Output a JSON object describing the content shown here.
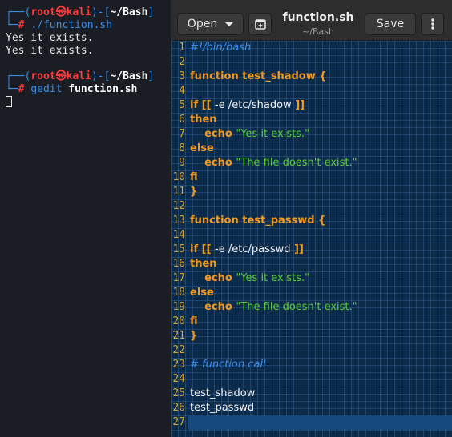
{
  "terminal": {
    "prompt1": {
      "user": "root",
      "at": "㉿",
      "host": "kali",
      "dir": "~/Bash",
      "command": "./function.sh"
    },
    "output": [
      "Yes it exists.",
      "Yes it exists."
    ],
    "prompt2": {
      "user": "root",
      "at": "㉿",
      "host": "kali",
      "dir": "~/Bash",
      "command_cmd": "gedit",
      "command_arg": "function.sh"
    }
  },
  "gedit": {
    "open_label": "Open",
    "save_label": "Save",
    "title": "function.sh",
    "subtitle": "~/Bash",
    "icons": {
      "open_dropdown": "chevron-down-icon",
      "new_tab": "new-tab-icon",
      "menu": "vertical-ellipsis-icon"
    },
    "current_line": 27,
    "lines": [
      {
        "n": "1",
        "parts": [
          {
            "t": "#!/bin/bash",
            "c": "shebang"
          }
        ]
      },
      {
        "n": "2",
        "parts": []
      },
      {
        "n": "3",
        "parts": [
          {
            "t": "function test_shadow {",
            "c": "kw"
          }
        ]
      },
      {
        "n": "4",
        "parts": []
      },
      {
        "n": "5",
        "parts": [
          {
            "t": "if [[ ",
            "c": "kw"
          },
          {
            "t": "-e /etc/shadow",
            "c": "plain"
          },
          {
            "t": " ]]",
            "c": "kw"
          }
        ]
      },
      {
        "n": "6",
        "parts": [
          {
            "t": "then",
            "c": "kw"
          }
        ]
      },
      {
        "n": "7",
        "parts": [
          {
            "t": "    echo ",
            "c": "kw"
          },
          {
            "t": "\"Yes it exists.\"",
            "c": "str"
          }
        ]
      },
      {
        "n": "8",
        "parts": [
          {
            "t": "else",
            "c": "kw"
          }
        ]
      },
      {
        "n": "9",
        "parts": [
          {
            "t": "    echo ",
            "c": "kw"
          },
          {
            "t": "\"The file doesn't exist.\"",
            "c": "str"
          }
        ]
      },
      {
        "n": "10",
        "parts": [
          {
            "t": "fi",
            "c": "kw"
          }
        ]
      },
      {
        "n": "11",
        "parts": [
          {
            "t": "}",
            "c": "kw"
          }
        ]
      },
      {
        "n": "12",
        "parts": []
      },
      {
        "n": "13",
        "parts": [
          {
            "t": "function test_passwd {",
            "c": "kw"
          }
        ]
      },
      {
        "n": "14",
        "parts": []
      },
      {
        "n": "15",
        "parts": [
          {
            "t": "if [[ ",
            "c": "kw"
          },
          {
            "t": "-e /etc/passwd",
            "c": "plain"
          },
          {
            "t": " ]]",
            "c": "kw"
          }
        ]
      },
      {
        "n": "16",
        "parts": [
          {
            "t": "then",
            "c": "kw"
          }
        ]
      },
      {
        "n": "17",
        "parts": [
          {
            "t": "    echo ",
            "c": "kw"
          },
          {
            "t": "\"Yes it exists.\"",
            "c": "str"
          }
        ]
      },
      {
        "n": "18",
        "parts": [
          {
            "t": "else",
            "c": "kw"
          }
        ]
      },
      {
        "n": "19",
        "parts": [
          {
            "t": "    echo ",
            "c": "kw"
          },
          {
            "t": "\"The file doesn't exist.\"",
            "c": "str"
          }
        ]
      },
      {
        "n": "20",
        "parts": [
          {
            "t": "fi",
            "c": "kw"
          }
        ]
      },
      {
        "n": "21",
        "parts": [
          {
            "t": "}",
            "c": "kw"
          }
        ]
      },
      {
        "n": "22",
        "parts": []
      },
      {
        "n": "23",
        "parts": [
          {
            "t": "# function call",
            "c": "com"
          }
        ]
      },
      {
        "n": "24",
        "parts": []
      },
      {
        "n": "25",
        "parts": [
          {
            "t": "test_shadow",
            "c": "plain"
          }
        ]
      },
      {
        "n": "26",
        "parts": [
          {
            "t": "test_passwd",
            "c": "plain"
          }
        ]
      },
      {
        "n": "27",
        "parts": []
      }
    ]
  }
}
